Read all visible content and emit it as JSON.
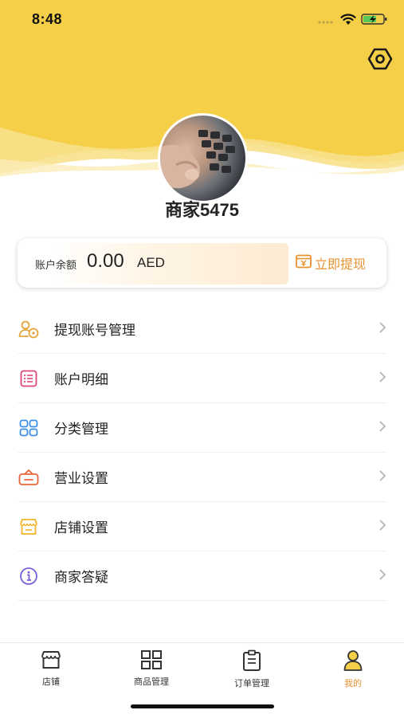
{
  "status_bar": {
    "time": "8:48"
  },
  "profile": {
    "merchant_name": "商家5475"
  },
  "balance": {
    "label": "账户余额",
    "amount": "0.00",
    "currency": "AED",
    "withdraw_label": "立即提现"
  },
  "menu": {
    "items": [
      {
        "label": "提现账号管理",
        "icon": "withdraw-account-icon",
        "color": "#e8a23a"
      },
      {
        "label": "账户明细",
        "icon": "list-detail-icon",
        "color": "#e0457b"
      },
      {
        "label": "分类管理",
        "icon": "category-grid-icon",
        "color": "#3a8ee6"
      },
      {
        "label": "营业设置",
        "icon": "business-sign-icon",
        "color": "#e8663a"
      },
      {
        "label": "店铺设置",
        "icon": "store-icon",
        "color": "#f0b42a"
      },
      {
        "label": "商家答疑",
        "icon": "info-icon",
        "color": "#7b5fd6"
      }
    ]
  },
  "tabbar": {
    "tabs": [
      {
        "label": "店铺",
        "icon": "store-tab-icon",
        "active": false
      },
      {
        "label": "商品管理",
        "icon": "grid-tab-icon",
        "active": false
      },
      {
        "label": "订单管理",
        "icon": "clipboard-tab-icon",
        "active": false
      },
      {
        "label": "我的",
        "icon": "person-tab-icon",
        "active": true
      }
    ]
  },
  "colors": {
    "header_yellow": "#f5cf47",
    "accent_orange": "#e8922f"
  }
}
